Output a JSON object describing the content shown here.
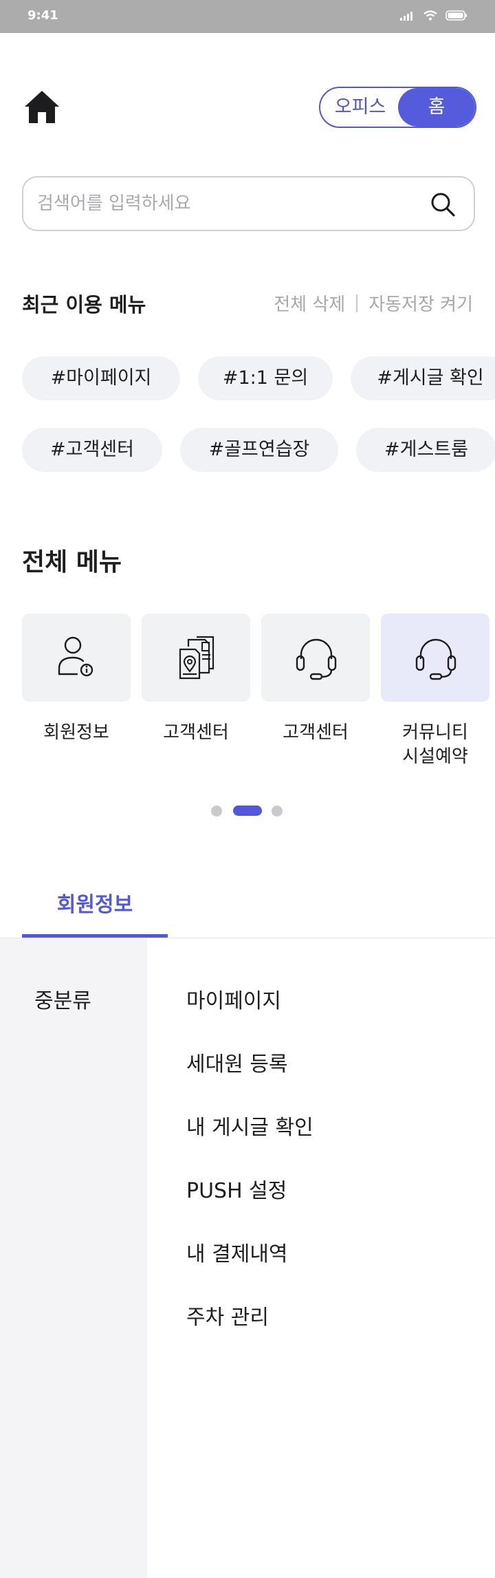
{
  "status_bar": {
    "time": "9:41"
  },
  "mode_toggle": {
    "office": "오피스",
    "home": "홈"
  },
  "search": {
    "placeholder": "검색어를 입력하세요"
  },
  "recent": {
    "title": "최근 이용 메뉴",
    "delete_all": "전체 삭제",
    "autosave": "자동저장 켜기",
    "chips": [
      "#마이페이지",
      "#1:1 문의",
      "#게시글 확인",
      "#고객센터",
      "#골프연습장",
      "#게스트룸"
    ]
  },
  "all_menu": {
    "title": "전체 메뉴",
    "items": [
      {
        "label": "회원정보",
        "icon": "member-info-icon"
      },
      {
        "label": "고객센터",
        "icon": "document-location-icon"
      },
      {
        "label": "고객센터",
        "icon": "headset-icon"
      },
      {
        "label": "커뮤니티\n시설예약",
        "icon": "headset-icon"
      }
    ],
    "pagination": {
      "pages": 3,
      "current": 2
    }
  },
  "tabs": {
    "active": "회원정보"
  },
  "category": {
    "label": "중분류"
  },
  "sub_menu": [
    "마이페이지",
    "세대원 등록",
    "내 게시글 확인",
    "PUSH 설정",
    "내 결제내역",
    "주차 관리"
  ],
  "colors": {
    "accent": "#5158d9",
    "chip_bg": "#f1f2f6",
    "card_bg": "#f1f2f4",
    "status_bar": "#acacac"
  }
}
